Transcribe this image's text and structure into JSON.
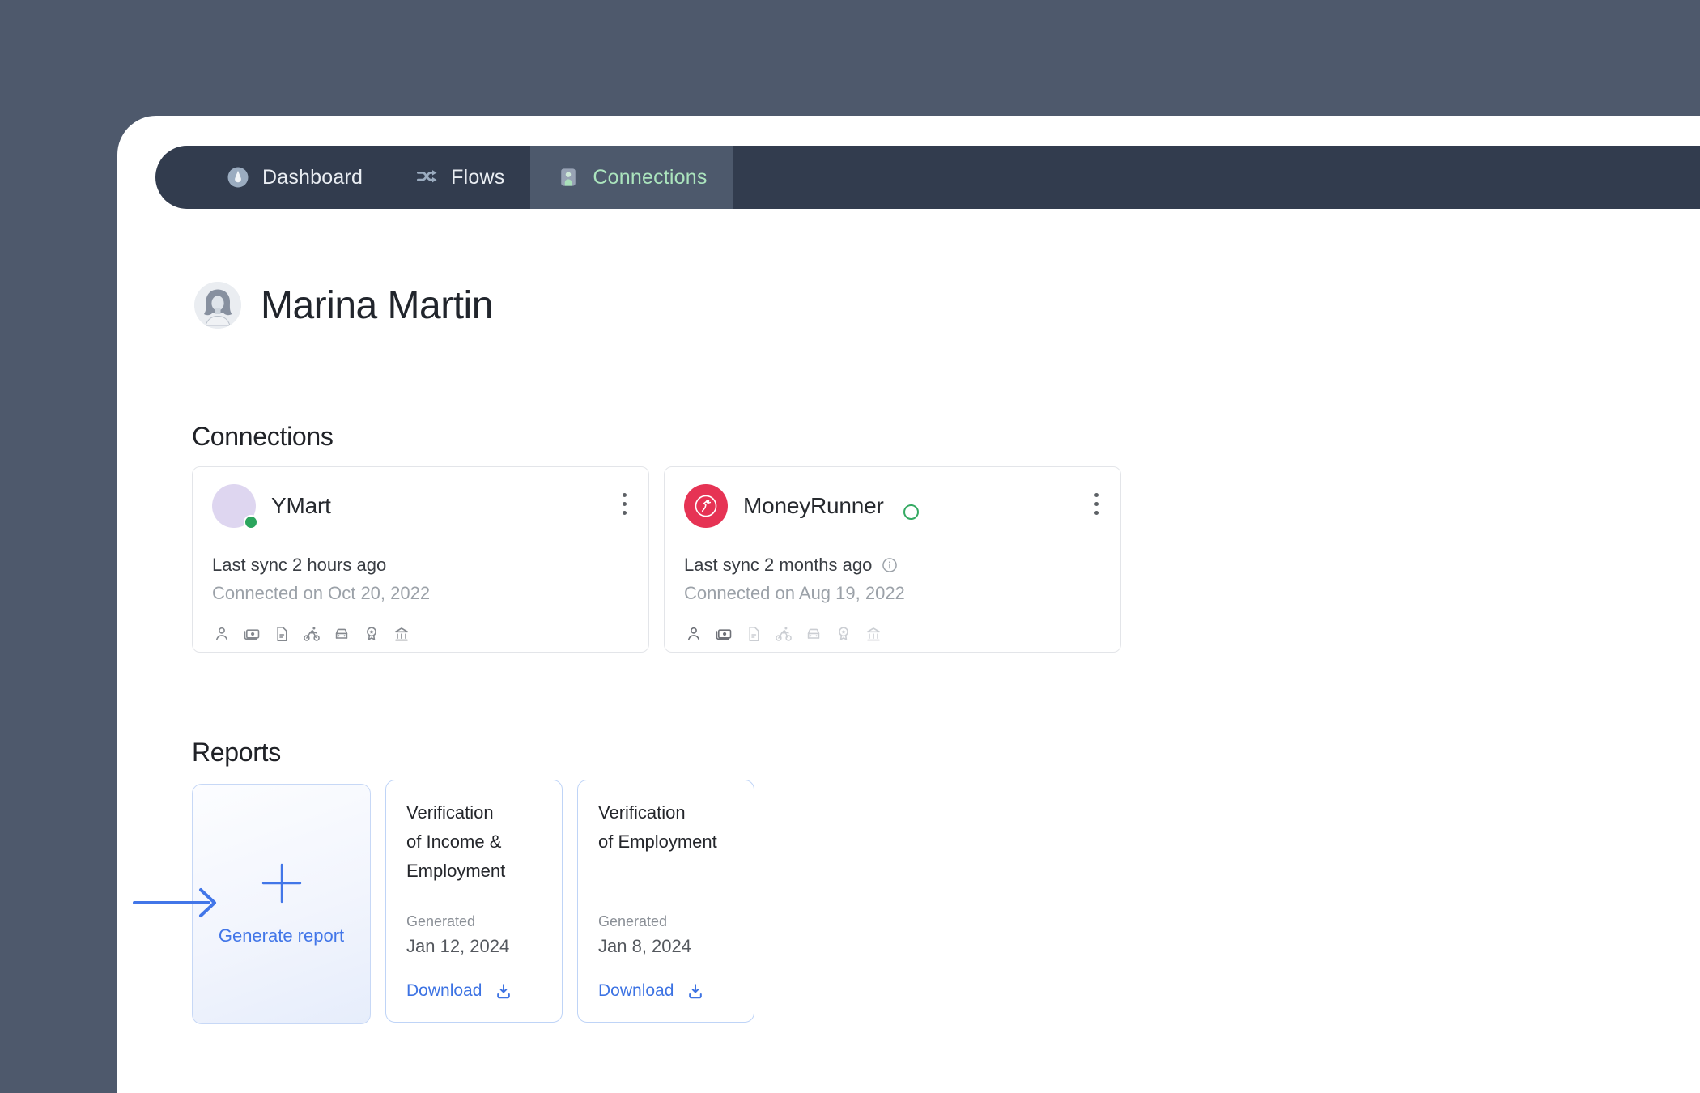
{
  "nav": {
    "tabs": [
      {
        "label": "Dashboard",
        "icon": "gauge-icon",
        "active": false
      },
      {
        "label": "Flows",
        "icon": "shuffle-icon",
        "active": false
      },
      {
        "label": "Connections",
        "icon": "id-badge-icon",
        "active": true
      }
    ]
  },
  "user": {
    "name": "Marina Martin",
    "avatar": "engraved-portrait"
  },
  "connections": {
    "heading": "Connections",
    "cards": [
      {
        "name": "YMart",
        "last_sync": "Last sync 2 hours ago",
        "connected_on": "Connected on Oct 20, 2022",
        "logo": {
          "icon": "branch-arrow-icon",
          "bg": "#DED6F0",
          "fg": "#4A3A92"
        },
        "status_dot_color": "#2BA55D",
        "capabilities": [
          "person-icon",
          "payments-icon",
          "document-icon",
          "bike-icon",
          "car-icon",
          "badge-icon",
          "bank-icon"
        ],
        "capabilities_enabled": 7
      },
      {
        "name": "MoneyRunner",
        "last_sync": "Last sync 2 months ago",
        "connected_on": "Connected on Aug 19, 2022",
        "logo": {
          "icon": "runner-icon",
          "bg": "#E63354",
          "fg": "#FFFFFF"
        },
        "pending_ring_color": "#35AA63",
        "has_info_icon": true,
        "capabilities": [
          "person-icon",
          "payments-icon",
          "document-icon",
          "bike-icon",
          "car-icon",
          "badge-icon",
          "bank-icon"
        ],
        "capabilities_enabled": 2
      }
    ]
  },
  "reports": {
    "heading": "Reports",
    "generate_card": {
      "label": "Generate report",
      "icon": "plus-icon"
    },
    "cards": [
      {
        "title_lines": [
          "Verification",
          "of Income &",
          "Employment"
        ],
        "generated_label": "Generated",
        "date": "Jan 12, 2024",
        "download_label": "Download"
      },
      {
        "title_lines": [
          "Verification",
          "of Employment"
        ],
        "generated_label": "Generated",
        "date": "Jan 8, 2024",
        "download_label": "Download"
      }
    ]
  },
  "colors": {
    "page_bg": "#4E596C",
    "navbar_bg": "#323C4E",
    "active_tab_bg": "#4D596C",
    "active_tab_text": "#ABE4BD",
    "tab_text": "#E9EDF2",
    "accent_blue": "#4276E8",
    "link_blue": "#3D73E3",
    "muted_text": "#9BA1A8",
    "card_border": "#E3E5E9",
    "report_card_border": "#BFD4F7",
    "status_green": "#2BA55D"
  }
}
